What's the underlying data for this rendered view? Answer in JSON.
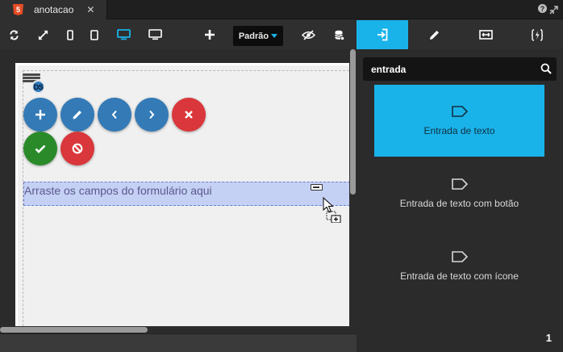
{
  "tab": {
    "title": "anotacao",
    "badge": "5"
  },
  "window": {
    "help": "?"
  },
  "toolbar": {
    "breakpoint_label": "Padrão"
  },
  "canvas": {
    "ds_label": "DS",
    "dropzone_text": "Arraste os campos do formulário aqui"
  },
  "panel": {
    "search_value": "entrada",
    "components": [
      {
        "label": "Entrada de texto",
        "icon": "tag-icon"
      },
      {
        "label": "Entrada de texto com botão",
        "icon": "tag-icon"
      },
      {
        "label": "Entrada de texto com ícone",
        "icon": "tag-icon"
      }
    ],
    "page": "1"
  },
  "colors": {
    "accent": "#19b3ea",
    "blue": "#337ab7",
    "red": "#d9373b",
    "green": "#2a8a2a"
  }
}
